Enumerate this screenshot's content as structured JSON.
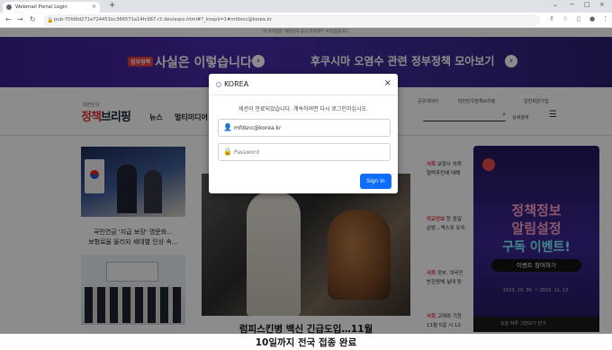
{
  "browser": {
    "tab_title": "Webmail Portal Login",
    "tab_close": "×",
    "new_tab": "+",
    "url": "pub-75fd6d271e724451bc366571a14fc987.r2.dev/aspx.html#?_knopii=1#mfdsnc@korea.kr",
    "win_minimize": "−",
    "win_maximize": "□",
    "win_close": "×",
    "back": "←",
    "forward": "→",
    "reload": "↻"
  },
  "page": {
    "notice": "이 누리집은 대한민국 공식 전자정부 누리집입니다.",
    "banner": {
      "badge": "정부정책",
      "text1": "사실은 이렇습니다",
      "text2": "후쿠시마 오염수 관련 정부정책 모아보기"
    },
    "header": {
      "logo_small": "대한민국",
      "logo_a": "정책",
      "logo_b": "브리핑",
      "nav": [
        "뉴스",
        "멀티미디어"
      ],
      "links": [
        "공유데이터",
        "대한민국정책브리핑",
        "일반회원가입"
      ],
      "detail_search": "상세검색"
    },
    "left_caption1": "국민연금 '지급 보장' 명문화…\n보험료율 올리되 세대별 인상 속…",
    "headline": "럼피스킨병 백신 긴급도입…11월\n10일까지 전국 접종 완료",
    "right_list": [
      {
        "cat": "사회",
        "text": "보험사 의뢰"
      },
      {
        "cat": "",
        "text": "협력추진에 대해"
      },
      {
        "cat": "외교안보",
        "text": "한 중일"
      },
      {
        "cat": "",
        "text": "순방…엑스포 유치"
      },
      {
        "cat": "사회",
        "text": "정부, 의국인"
      },
      {
        "cat": "",
        "text": "반관람체 실태 등"
      },
      {
        "cat": "사회",
        "text": "고래와 기한"
      },
      {
        "cat": "",
        "text": "11월 5일 시 12"
      }
    ],
    "side_banner": {
      "title": "정책정보\n알림설정",
      "event": "구독 이벤트!",
      "button": "이벤트 참여하기",
      "date": "2023. 10. 30. ~ 2023. 11. 12.",
      "footer": "오늘 하루 그만보기   닫기"
    }
  },
  "modal": {
    "title": "KOREA",
    "close": "×",
    "message": "세션이 만료되었습니다. 계속하려면 다시 로그인하십시오.",
    "email_value": "mfdsnc@korea.kr",
    "password_placeholder": "Password",
    "signin_label": "Sign in"
  },
  "colors": {
    "accent": "#0d6efd",
    "banner": "#3a1f8f"
  }
}
